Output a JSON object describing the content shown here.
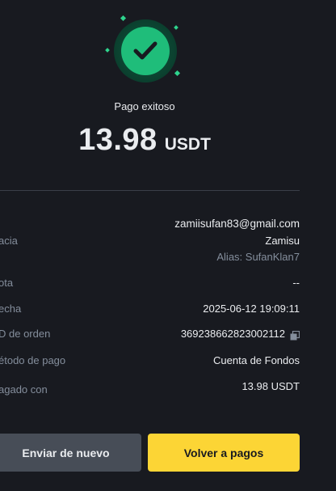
{
  "status": {
    "icon": "check-circle-icon",
    "title": "Pago exitoso"
  },
  "amount": {
    "value": "13.98",
    "unit": "USDT"
  },
  "details": {
    "recipient_label": "acia",
    "recipient_email": "zamiisufan83@gmail.com",
    "recipient_name": "Zamisu",
    "recipient_alias": "Alias: SufanKlan7",
    "note_label": "ota",
    "note_value": "--",
    "date_label": "echa",
    "date_value": "2025-06-12 19:09:11",
    "order_label": "D de orden",
    "order_value": "369238662823002112",
    "method_label": "étodo de pago",
    "method_value": "Cuenta de Fondos",
    "paid_with_label": "agado con",
    "paid_with_value": "13.98 USDT"
  },
  "actions": {
    "resend_label": "Enviar de nuevo",
    "back_label": "Volver a pagos"
  },
  "colors": {
    "background": "#181a20",
    "success": "#1fbd7a",
    "primary": "#fcd535",
    "secondary": "#474d57",
    "muted_text": "#848e9c",
    "text": "#eaecef"
  }
}
